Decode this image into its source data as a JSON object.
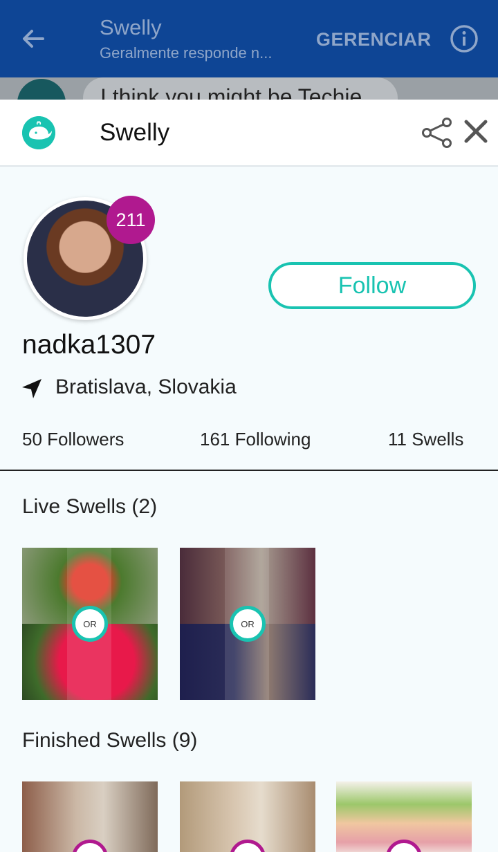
{
  "appbar": {
    "title": "Swelly",
    "subtitle": "Geralmente responde n...",
    "manage_label": "GERENCIAR"
  },
  "behind": {
    "message": "I think you might be Techie"
  },
  "sheet": {
    "title": "Swelly"
  },
  "profile": {
    "badge": "211",
    "follow_label": "Follow",
    "username": "nadka1307",
    "location": "Bratislava, Slovakia",
    "followers": "50 Followers",
    "following": "161 Following",
    "swells": "11 Swells"
  },
  "live": {
    "title": "Live Swells (2)",
    "or_label": "OR"
  },
  "finished": {
    "title": "Finished Swells (9)"
  },
  "colors": {
    "brand": "#0e4595",
    "accent": "#19c3b1",
    "badge": "#b0198f"
  }
}
